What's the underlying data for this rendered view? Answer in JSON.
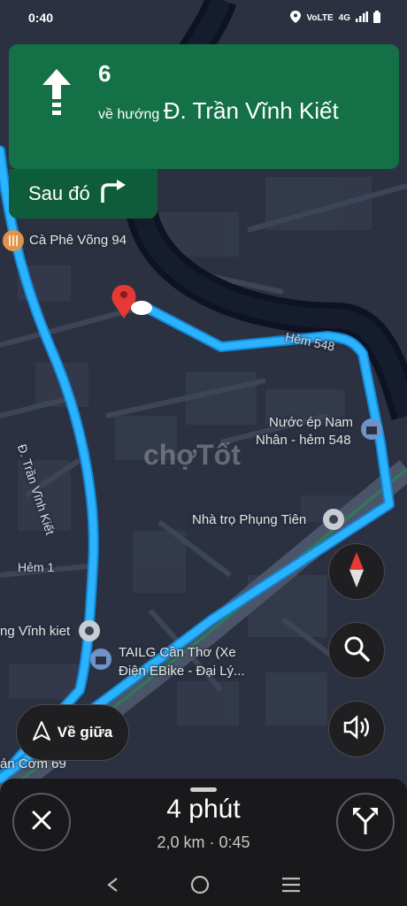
{
  "status": {
    "time": "0:40",
    "network": "4G",
    "volte": "VoLTE"
  },
  "nav": {
    "distance": "6",
    "toward_prefix": "về hướng",
    "toward_street": "Đ. Trần Vĩnh Kiết",
    "then_label": "Sau đó",
    "maneuver_icon": "straight-arrow-icon",
    "then_icon": "turn-right-icon"
  },
  "map": {
    "places": [
      {
        "name": "Cà Phê Võng 94",
        "icon": "restaurant-icon"
      },
      {
        "name": "Nước ép Nam",
        "icon": "shopping-bag-icon"
      },
      {
        "name": "Nhân - hẻm 548",
        "icon": ""
      },
      {
        "name": "Nhà trọ Phụng Tiên",
        "icon": "place-pin-icon"
      },
      {
        "name": "TAILG Cần Thơ (Xe",
        "icon": "shopping-bag-icon"
      },
      {
        "name": "Điện EBike - Đại Lý...",
        "icon": ""
      },
      {
        "name": "ng Vĩnh kiet",
        "icon": "place-pin-icon"
      },
      {
        "name": "án Cơm 69",
        "icon": ""
      }
    ],
    "streets": {
      "hem548": "Hẻm 548",
      "tran_vinh_kiet": "Đ. Trần Vĩnh Kiết",
      "hem1": "Hẻm 1"
    },
    "watermark": "chợTốt",
    "route_color": "#2bb3ff",
    "water_color": "#0d1322"
  },
  "controls": {
    "recenter_label": "Về giữa",
    "compass_icon": "compass-icon",
    "search_icon": "search-icon",
    "sound_icon": "volume-icon"
  },
  "bottom": {
    "eta_time": "4 phút",
    "eta_details": "2,0 km · 0:45",
    "close_icon": "close-icon",
    "routes_icon": "alternate-routes-icon"
  }
}
